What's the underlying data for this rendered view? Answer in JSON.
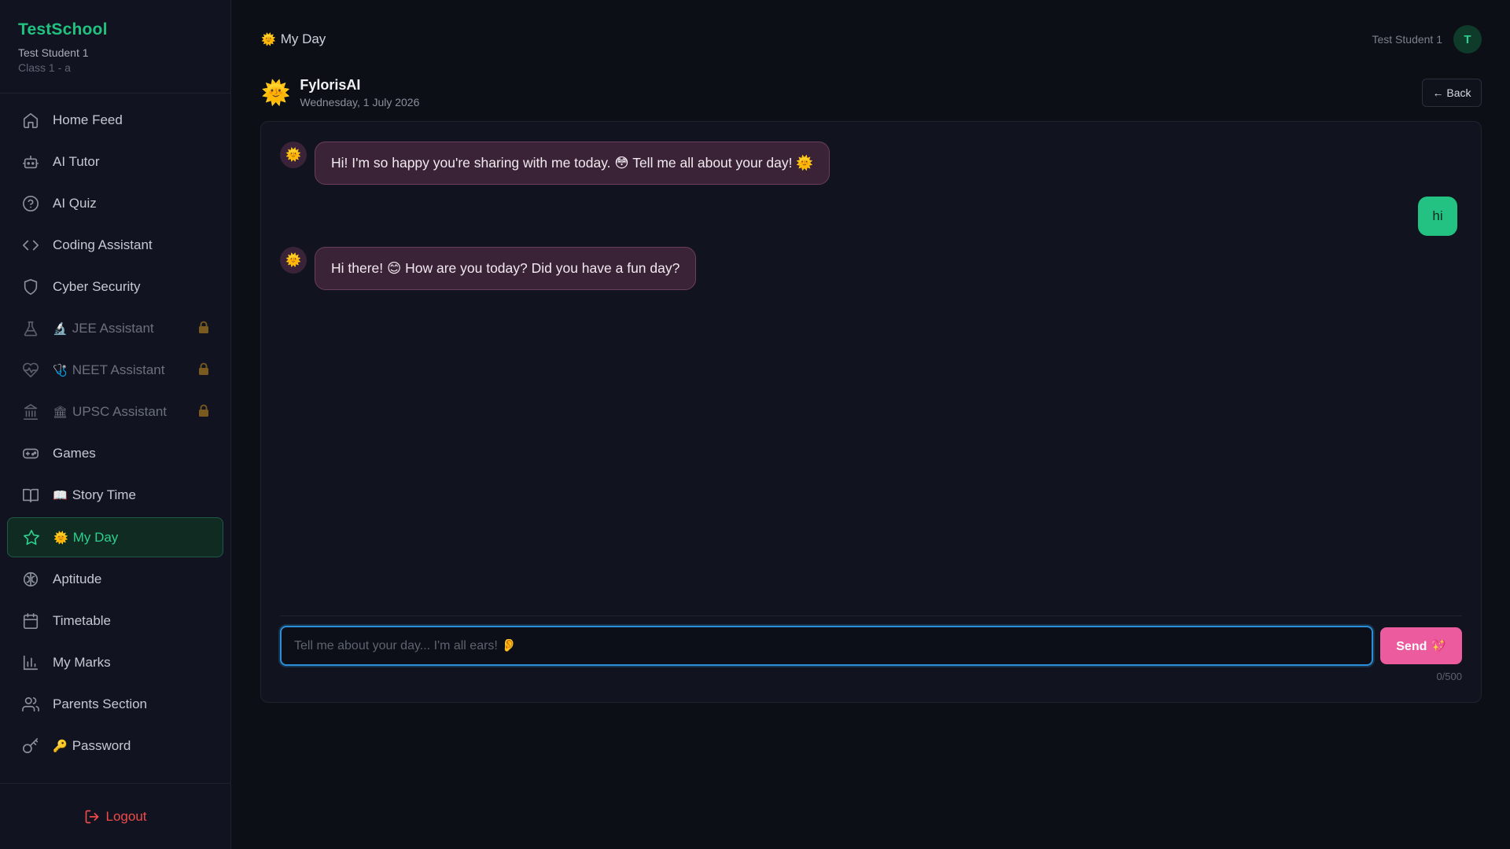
{
  "brand": {
    "name": "TestSchool",
    "user": "Test Student 1",
    "class": "Class 1 - a"
  },
  "nav": [
    {
      "label": "Home Feed",
      "icon": "home-icon",
      "emoji": "",
      "locked": false,
      "active": false
    },
    {
      "label": "AI Tutor",
      "icon": "bot-icon",
      "emoji": "",
      "locked": false,
      "active": false
    },
    {
      "label": "AI Quiz",
      "icon": "help-circle-icon",
      "emoji": "",
      "locked": false,
      "active": false
    },
    {
      "label": "Coding Assistant",
      "icon": "code-icon",
      "emoji": "",
      "locked": false,
      "active": false
    },
    {
      "label": "Cyber Security",
      "icon": "shield-icon",
      "emoji": "",
      "locked": false,
      "active": false
    },
    {
      "label": "JEE Assistant",
      "icon": "flask-icon",
      "emoji": "🔬",
      "locked": true,
      "active": false
    },
    {
      "label": "NEET Assistant",
      "icon": "heart-pulse-icon",
      "emoji": "🩺",
      "locked": true,
      "active": false
    },
    {
      "label": "UPSC Assistant",
      "icon": "landmark-icon",
      "emoji": "🏛",
      "locked": true,
      "active": false
    },
    {
      "label": "Games",
      "icon": "gamepad-icon",
      "emoji": "",
      "locked": false,
      "active": false
    },
    {
      "label": "Story Time",
      "icon": "book-icon",
      "emoji": "📖",
      "locked": false,
      "active": false
    },
    {
      "label": "My Day",
      "icon": "star-icon",
      "emoji": "🌞",
      "locked": false,
      "active": true
    },
    {
      "label": "Aptitude",
      "icon": "brain-icon",
      "emoji": "",
      "locked": false,
      "active": false
    },
    {
      "label": "Timetable",
      "icon": "calendar-icon",
      "emoji": "",
      "locked": false,
      "active": false
    },
    {
      "label": "My Marks",
      "icon": "bar-chart-icon",
      "emoji": "",
      "locked": false,
      "active": false
    },
    {
      "label": "Parents Section",
      "icon": "users-icon",
      "emoji": "",
      "locked": false,
      "active": false
    },
    {
      "label": "Password",
      "icon": "key-icon",
      "emoji": "🔑",
      "locked": false,
      "active": false
    }
  ],
  "logout": {
    "label": "Logout",
    "icon": "log-out-icon"
  },
  "topbar": {
    "title": "My Day",
    "emoji": "🌞",
    "user_name": "Test Student 1",
    "avatar_letter": "T"
  },
  "chat": {
    "bot_name": "FylorisAI",
    "date": "Wednesday, 1 July 2026",
    "back_label": "← Back",
    "messages": [
      {
        "from": "bot",
        "text": "Hi! I'm so happy you're sharing with me today. 😳 Tell me all about your day! 🌞"
      },
      {
        "from": "user",
        "text": "hi"
      },
      {
        "from": "bot",
        "text": "Hi there! 😊 How are you today? Did you have a fun day?"
      }
    ],
    "input_placeholder": "Tell me about your day... I'm all ears! 👂",
    "input_value": "",
    "send_label": "Send 💖",
    "counter": "0/500"
  },
  "colors": {
    "accent": "#21c27f",
    "bot_bubble": "#3a2336",
    "user_bubble": "#23c283",
    "send": "#ec5b9e",
    "logout": "#f04a4a"
  }
}
